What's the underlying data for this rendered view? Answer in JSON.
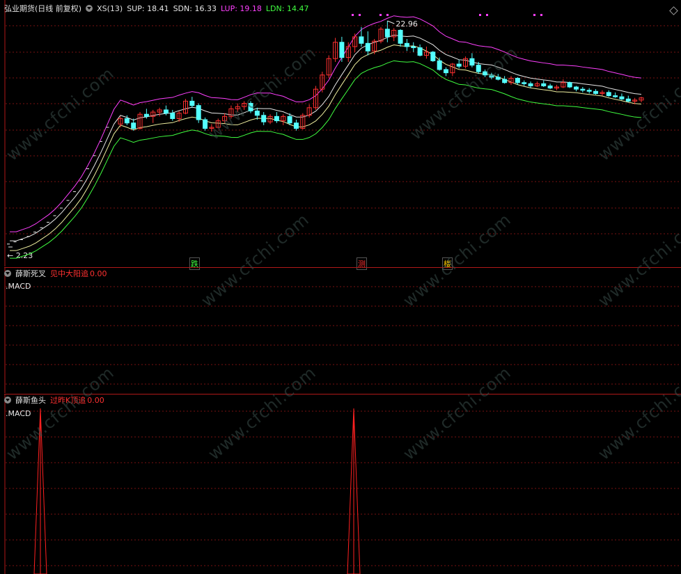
{
  "main": {
    "title": "弘业期货(日线 前复权)",
    "indicator": "XS(13)",
    "sup": "SUP: 18.41",
    "sdn": "SDN: 16.33",
    "lup": "LUP: 19.18",
    "ldn": "LDN: 14.47",
    "high_label": "22.96",
    "low_label": "2.23",
    "signals": [
      "跌",
      "测",
      "楼"
    ],
    "colors": {
      "sup": "#e8e8e8",
      "sdn": "#e8e8e8",
      "lup": "#ff40ff",
      "ldn": "#40ff40",
      "up": "#ff3030",
      "down": "#54ffff"
    },
    "candles": [
      [
        13.5,
        14.2,
        13.2,
        14.0
      ],
      [
        14.0,
        14.3,
        13.4,
        13.6
      ],
      [
        13.6,
        14.0,
        12.9,
        13.1
      ],
      [
        13.1,
        14.6,
        13.0,
        14.4
      ],
      [
        14.4,
        14.9,
        14.0,
        14.2
      ],
      [
        14.2,
        14.8,
        13.6,
        14.6
      ],
      [
        14.6,
        15.0,
        14.2,
        14.8
      ],
      [
        14.8,
        15.2,
        14.3,
        14.5
      ],
      [
        14.5,
        14.8,
        13.8,
        14.0
      ],
      [
        14.0,
        14.7,
        13.7,
        14.5
      ],
      [
        14.5,
        15.8,
        14.4,
        15.6
      ],
      [
        15.6,
        16.0,
        15.0,
        15.2
      ],
      [
        15.2,
        15.4,
        13.6,
        13.9
      ],
      [
        13.9,
        14.1,
        12.9,
        13.1
      ],
      [
        13.1,
        13.5,
        12.8,
        13.2
      ],
      [
        13.2,
        14.0,
        13.1,
        13.8
      ],
      [
        13.8,
        14.5,
        13.6,
        14.2
      ],
      [
        14.2,
        15.2,
        14.0,
        14.9
      ],
      [
        14.9,
        15.4,
        14.6,
        15.1
      ],
      [
        15.1,
        15.6,
        14.8,
        15.4
      ],
      [
        15.4,
        15.6,
        14.5,
        14.7
      ],
      [
        14.7,
        15.0,
        13.9,
        14.3
      ],
      [
        14.3,
        14.6,
        13.4,
        13.7
      ],
      [
        13.7,
        14.4,
        13.5,
        14.2
      ],
      [
        14.2,
        14.6,
        13.6,
        13.8
      ],
      [
        13.8,
        14.4,
        13.4,
        14.2
      ],
      [
        14.2,
        14.5,
        13.4,
        13.6
      ],
      [
        13.6,
        13.9,
        12.9,
        13.1
      ],
      [
        13.1,
        14.5,
        13.0,
        14.3
      ],
      [
        14.3,
        15.3,
        14.1,
        15.0
      ],
      [
        15.0,
        17.0,
        14.8,
        16.7
      ],
      [
        16.7,
        18.3,
        16.4,
        18.0
      ],
      [
        18.0,
        19.8,
        17.7,
        19.5
      ],
      [
        19.5,
        21.4,
        19.2,
        21.0
      ],
      [
        21.0,
        21.5,
        19.2,
        19.6
      ],
      [
        19.6,
        21.0,
        19.2,
        20.6
      ],
      [
        20.6,
        21.8,
        20.1,
        21.5
      ],
      [
        21.5,
        22.4,
        20.6,
        20.9
      ],
      [
        20.9,
        22.0,
        19.8,
        20.2
      ],
      [
        20.2,
        21.3,
        19.9,
        21.1
      ],
      [
        21.1,
        22.4,
        20.9,
        22.2
      ],
      [
        22.2,
        22.96,
        21.0,
        21.5
      ],
      [
        21.5,
        22.3,
        21.1,
        22.1
      ],
      [
        22.1,
        22.2,
        20.6,
        20.9
      ],
      [
        20.9,
        21.3,
        20.2,
        20.6
      ],
      [
        20.6,
        21.0,
        20.1,
        20.5
      ],
      [
        20.5,
        20.8,
        19.7,
        19.8
      ],
      [
        19.8,
        20.6,
        19.5,
        20.1
      ],
      [
        20.1,
        20.2,
        19.2,
        19.3
      ],
      [
        19.3,
        19.6,
        18.4,
        18.5
      ],
      [
        18.5,
        18.7,
        17.9,
        18.2
      ],
      [
        18.2,
        19.1,
        17.9,
        19.0
      ],
      [
        19.0,
        19.4,
        18.6,
        18.8
      ],
      [
        18.8,
        19.7,
        18.6,
        19.5
      ],
      [
        19.5,
        20.0,
        18.7,
        18.9
      ],
      [
        18.9,
        19.2,
        18.1,
        18.3
      ],
      [
        18.3,
        18.5,
        17.8,
        18.0
      ],
      [
        18.0,
        18.2,
        17.6,
        17.8
      ],
      [
        17.8,
        18.1,
        17.5,
        17.6
      ],
      [
        17.6,
        17.9,
        17.2,
        17.3
      ],
      [
        17.3,
        17.9,
        17.1,
        17.7
      ],
      [
        17.7,
        17.8,
        17.1,
        17.3
      ],
      [
        17.3,
        17.5,
        17.0,
        17.2
      ],
      [
        17.2,
        17.4,
        16.8,
        17.0
      ],
      [
        17.0,
        17.4,
        16.9,
        17.2
      ],
      [
        17.2,
        17.5,
        16.9,
        17.0
      ],
      [
        17.0,
        17.2,
        16.7,
        16.8
      ],
      [
        16.8,
        17.1,
        16.6,
        16.9
      ],
      [
        16.9,
        17.6,
        16.8,
        17.3
      ],
      [
        17.3,
        17.4,
        16.8,
        16.9
      ],
      [
        16.9,
        17.0,
        16.5,
        16.7
      ],
      [
        16.7,
        16.9,
        16.4,
        16.6
      ],
      [
        16.6,
        16.8,
        16.3,
        16.5
      ],
      [
        16.5,
        16.7,
        16.2,
        16.3
      ],
      [
        16.3,
        16.6,
        16.1,
        16.4
      ],
      [
        16.4,
        16.6,
        16.0,
        16.1
      ],
      [
        16.1,
        16.4,
        15.9,
        16.0
      ],
      [
        16.0,
        16.3,
        15.7,
        15.8
      ],
      [
        15.8,
        16.1,
        15.5,
        15.6
      ],
      [
        15.6,
        15.9,
        15.3,
        15.7
      ],
      [
        15.7,
        16.0,
        15.5,
        15.9
      ]
    ]
  },
  "panel2": {
    "name": "薛斯死叉",
    "signal": "见中大阳追",
    "value": "0.00",
    "sub": ".MACD"
  },
  "panel3": {
    "name": "薛斯鱼头",
    "signal": "过昨K顶追",
    "value": "0.00",
    "sub": ".MACD"
  },
  "watermark": "www.cfchi.com"
}
